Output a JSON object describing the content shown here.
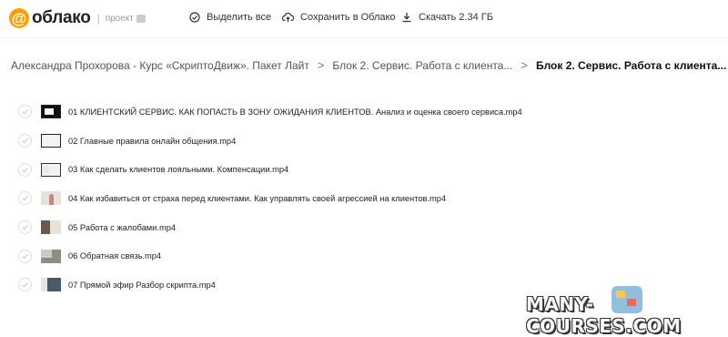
{
  "header": {
    "logo_at": "@",
    "logo_text": "облако",
    "logo_separator": "|",
    "project_label": "проект",
    "actions": {
      "select_all": "Выделить все",
      "save_to_cloud": "Сохранить в Облако",
      "download": "Скачать 2.34 ГБ"
    }
  },
  "breadcrumb": {
    "items": [
      "Александра Прохорова - Курс «СкриптоДвиж». Пакет Лайт",
      "Блок 2. Сервис. Работа с клиента...",
      "Блок 2. Сервис. Работа с клиента..."
    ],
    "separator": ">"
  },
  "files": [
    {
      "name": "01 КЛИЕНТСКИЙ СЕРВИС. КАК ПОПАСТЬ В ЗОНУ ОЖИДАНИЯ КЛИЕНТОВ. Анализ и оценка своего сервиса.mp4"
    },
    {
      "name": "02 Главные правила онлайн общения.mp4"
    },
    {
      "name": "03 Как сделать клиентов лояльными. Компенсации.mp4"
    },
    {
      "name": "04 Как избавиться от страха перед клиентами. Как управлять своей агрессией на клиентов.mp4"
    },
    {
      "name": "05 Работа с жалобами.mp4"
    },
    {
      "name": "06 Обратная связь.mp4"
    },
    {
      "name": "07 Прямой эфир Разбор скрипта.mp4"
    }
  ],
  "watermark": "MANY-COURSES.COM",
  "colors": {
    "brand": "#ff9e00",
    "text": "#222222",
    "muted": "#999999"
  }
}
